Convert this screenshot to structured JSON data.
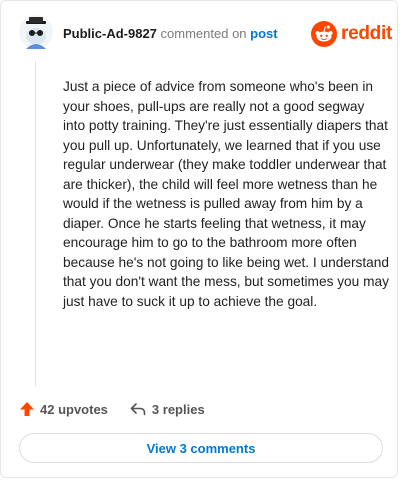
{
  "header": {
    "username": "Public-Ad-9827",
    "commented_text": "commented on",
    "post_link": "post",
    "logo_text": "reddit"
  },
  "comment": {
    "body": "Just a piece of advice from someone who's been in your shoes, pull-ups are really not a good segway into potty training. They're just essentially diapers that you pull up. Unfortunately, we learned that if you use regular underwear (they make toddler underwear that are thicker), the child will feel more wetness than he would if the wetness is pulled away from him by a diaper. Once he starts feeling that wetness, it may encourage him to go to the bathroom more often because he's not going to like being wet. I understand that you don't want the mess, but sometimes you may just have to suck it up to achieve the goal."
  },
  "actions": {
    "upvotes": "42 upvotes",
    "replies": "3 replies"
  },
  "footer": {
    "view_comments": "View 3 comments"
  },
  "colors": {
    "brand": "#ff4500",
    "link": "#0079d3",
    "upvote": "#ff4500"
  },
  "icons": {
    "avatar": "avatar-snoo-icon",
    "logo": "reddit-alien-icon",
    "upvote": "upvote-arrow-icon",
    "reply": "reply-arrow-icon"
  }
}
